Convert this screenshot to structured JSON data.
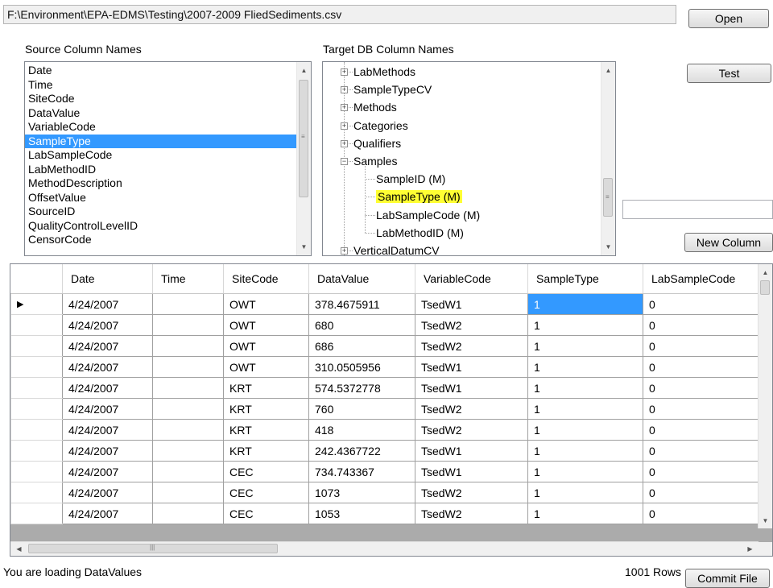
{
  "file_path": "F:\\Environment\\EPA-EDMS\\Testing\\2007-2009 FliedSediments.csv",
  "buttons": {
    "open": "Open",
    "test": "Test",
    "new_column": "New Column",
    "commit_file": "Commit File"
  },
  "source": {
    "label": "Source Column Names",
    "items": [
      "Date",
      "Time",
      "SiteCode",
      "DataValue",
      "VariableCode",
      "SampleType",
      "LabSampleCode",
      "LabMethodID",
      "MethodDescription",
      "OffsetValue",
      "SourceID",
      "QualityControlLevelID",
      "CensorCode"
    ],
    "selected": "SampleType"
  },
  "target": {
    "label": "Target DB Column Names",
    "nodes": [
      {
        "label": "LabMethods",
        "expanded": false
      },
      {
        "label": "SampleTypeCV",
        "expanded": false
      },
      {
        "label": "Methods",
        "expanded": false
      },
      {
        "label": "Categories",
        "expanded": false
      },
      {
        "label": "Qualifiers",
        "expanded": false
      },
      {
        "label": "Samples",
        "expanded": true,
        "children": [
          "SampleID (M)",
          "SampleType (M)",
          "LabSampleCode (M)",
          "LabMethodID (M)"
        ]
      },
      {
        "label": "VerticalDatumCV",
        "expanded": false
      }
    ],
    "highlighted": "SampleType (M)"
  },
  "new_column_value": "",
  "grid": {
    "columns": [
      "Date",
      "Time",
      "SiteCode",
      "DataValue",
      "VariableCode",
      "SampleType",
      "LabSampleCode"
    ],
    "rows": [
      [
        "4/24/2007",
        "",
        "OWT",
        "378.4675911",
        "TsedW1",
        "1",
        "0"
      ],
      [
        "4/24/2007",
        "",
        "OWT",
        "680",
        "TsedW2",
        "1",
        "0"
      ],
      [
        "4/24/2007",
        "",
        "OWT",
        "686",
        "TsedW2",
        "1",
        "0"
      ],
      [
        "4/24/2007",
        "",
        "OWT",
        "310.0505956",
        "TsedW1",
        "1",
        "0"
      ],
      [
        "4/24/2007",
        "",
        "KRT",
        "574.5372778",
        "TsedW1",
        "1",
        "0"
      ],
      [
        "4/24/2007",
        "",
        "KRT",
        "760",
        "TsedW2",
        "1",
        "0"
      ],
      [
        "4/24/2007",
        "",
        "KRT",
        "418",
        "TsedW2",
        "1",
        "0"
      ],
      [
        "4/24/2007",
        "",
        "KRT",
        "242.4367722",
        "TsedW1",
        "1",
        "0"
      ],
      [
        "4/24/2007",
        "",
        "CEC",
        "734.743367",
        "TsedW1",
        "1",
        "0"
      ],
      [
        "4/24/2007",
        "",
        "CEC",
        "1073",
        "TsedW2",
        "1",
        "0"
      ],
      [
        "4/24/2007",
        "",
        "CEC",
        "1053",
        "TsedW2",
        "1",
        "0"
      ]
    ]
  },
  "status_text": "You are loading DataValues",
  "row_count_text": "1001 Rows",
  "colors": {
    "selection": "#3399ff",
    "highlight": "#ffff33"
  }
}
